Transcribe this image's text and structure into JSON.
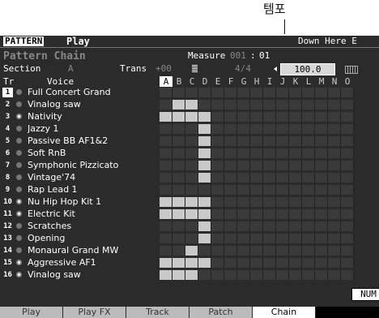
{
  "annotation": {
    "label": "템포"
  },
  "header": {
    "mode": "PATTERN",
    "submode": "Play",
    "song_name": "Down Here E"
  },
  "info": {
    "title": "Pattern Chain",
    "measure_label": "Measure",
    "measure_value": "001",
    "measure_sep": ":",
    "beat_in_measure": "01",
    "section_label": "Section",
    "section_value": "A",
    "trans_label": "Trans",
    "trans_value": "+00",
    "metronome_icon": "metronome-icon",
    "time_signature": "4/4",
    "tempo_value": "100.0",
    "keyboard_icon": "keyboard-icon"
  },
  "table": {
    "tr_header": "Tr",
    "voice_header": "Voice",
    "columns": [
      "A",
      "B",
      "C",
      "D",
      "E",
      "F",
      "G",
      "H",
      "I",
      "J",
      "K",
      "L",
      "M",
      "N",
      "O"
    ],
    "selected_column": 0,
    "tracks": [
      {
        "num": "1",
        "voice": "Full Concert Grand",
        "drum": false,
        "cells": []
      },
      {
        "num": "2",
        "voice": "Vinalog saw",
        "drum": false,
        "cells": [
          1,
          2
        ]
      },
      {
        "num": "3",
        "voice": "Nativity",
        "drum": true,
        "cells": [
          0,
          1,
          2,
          3
        ]
      },
      {
        "num": "4",
        "voice": "Jazzy 1",
        "drum": false,
        "cells": [
          3
        ]
      },
      {
        "num": "5",
        "voice": "Passive BB AF1&2",
        "drum": false,
        "cells": [
          3
        ]
      },
      {
        "num": "6",
        "voice": "Soft RnB",
        "drum": false,
        "cells": [
          3
        ]
      },
      {
        "num": "7",
        "voice": "Symphonic Pizzicato",
        "drum": false,
        "cells": [
          3
        ]
      },
      {
        "num": "8",
        "voice": "Vintage'74",
        "drum": false,
        "cells": [
          3
        ]
      },
      {
        "num": "9",
        "voice": "Rap Lead 1",
        "drum": false,
        "cells": []
      },
      {
        "num": "10",
        "voice": "Nu Hip Hop Kit 1",
        "drum": true,
        "cells": [
          0,
          1,
          2,
          3
        ]
      },
      {
        "num": "11",
        "voice": "Electric Kit",
        "drum": true,
        "cells": [
          0,
          1,
          2,
          3
        ]
      },
      {
        "num": "12",
        "voice": "Scratches",
        "drum": false,
        "cells": [
          3
        ]
      },
      {
        "num": "13",
        "voice": "Opening",
        "drum": false,
        "cells": [
          3
        ]
      },
      {
        "num": "14",
        "voice": "Monaural Grand MW",
        "drum": false,
        "cells": [
          2
        ]
      },
      {
        "num": "15",
        "voice": "Aggressive AF1",
        "drum": true,
        "cells": [
          0,
          1,
          2,
          3
        ]
      },
      {
        "num": "16",
        "voice": "Vinalog saw",
        "drum": true,
        "cells": [
          0,
          1,
          2
        ]
      }
    ]
  },
  "footer": {
    "num_button": "NUM",
    "tabs": [
      "Play",
      "Play FX",
      "Track",
      "Patch",
      "Chain",
      ""
    ],
    "active_tab": 4
  },
  "colors": {
    "screen_bg": "#2b2b2b",
    "cell_on": "#c9c9c9",
    "tempo_box": "#d8d8d8"
  }
}
